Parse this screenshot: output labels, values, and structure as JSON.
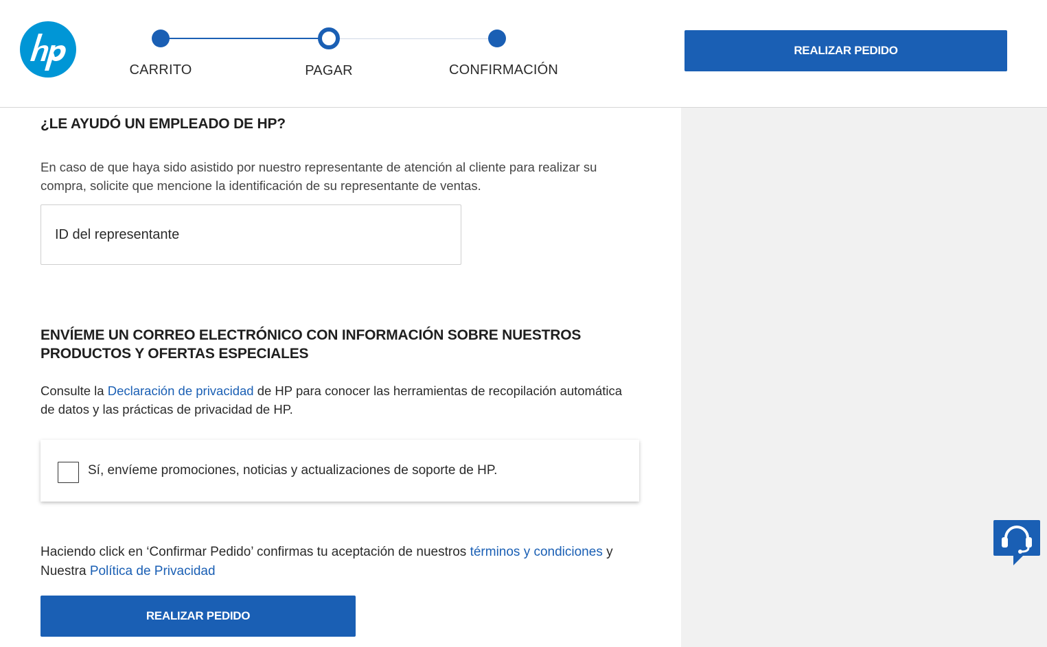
{
  "header": {
    "steps": [
      {
        "label": "CARRITO",
        "state": "done"
      },
      {
        "label": "PAGAR",
        "state": "current"
      },
      {
        "label": "CONFIRMACIÓN",
        "state": "pending"
      }
    ],
    "place_order_label": "REALIZAR PEDIDO"
  },
  "employee_section": {
    "title": "¿LE AYUDÓ UN EMPLEADO DE HP?",
    "description": "En caso de que haya sido asistido por nuestro representante de atención al cliente para realizar su compra, solicite que mencione la identificación de su representante de ventas.",
    "rep_id_placeholder": "ID del representante",
    "rep_id_value": ""
  },
  "email_section": {
    "title": "ENVÍEME UN CORREO ELECTRÓNICO CON INFORMACIÓN SOBRE NUESTROS PRODUCTOS Y OFERTAS ESPECIALES",
    "text_before": "Consulte la ",
    "privacy_link": "Declaración de privacidad",
    "text_after": " de HP para conocer las herramientas de recopilación automática de datos y las prácticas de privacidad de HP.",
    "optin_label": "Sí, envíeme promociones, noticias y actualizaciones de soporte de HP.",
    "optin_checked": false
  },
  "terms": {
    "text_before": "Haciendo click en ‘Confirmar Pedido’ confirmas tu aceptación de nuestros ",
    "terms_link": "términos y condiciones",
    "text_middle": " y Nuestra ",
    "policy_link": "Política de Privacidad"
  },
  "bottom": {
    "place_order_label": "REALIZAR PEDIDO"
  },
  "icons": {
    "logo": "hp-logo",
    "chat": "chat-support-icon"
  },
  "colors": {
    "brand_blue": "#1a5fb4",
    "logo_blue": "#0096d6",
    "panel_gray": "#f1f1f1"
  }
}
